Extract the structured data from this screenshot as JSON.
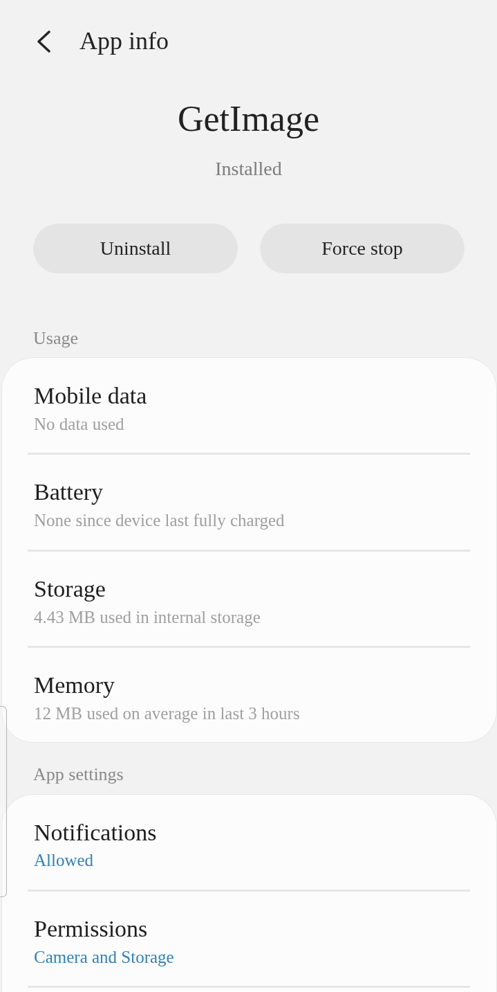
{
  "header": {
    "title": "App info"
  },
  "app": {
    "name": "GetImage",
    "status": "Installed"
  },
  "buttons": [
    {
      "label": "Uninstall"
    },
    {
      "label": "Force stop"
    }
  ],
  "sections": [
    {
      "title": "Usage",
      "continues": false,
      "items": [
        {
          "kind": "info",
          "title": "Mobile data",
          "summary": "No data used"
        },
        {
          "kind": "info",
          "title": "Battery",
          "summary": "None since device last fully charged"
        },
        {
          "kind": "info",
          "title": "Storage",
          "summary": "4.43 MB used in internal storage"
        },
        {
          "kind": "info",
          "title": "Memory",
          "summary": "12 MB used on average in last 3 hours"
        }
      ]
    },
    {
      "title": "App settings",
      "continues": true,
      "items": [
        {
          "kind": "value",
          "title": "Notifications",
          "summary": "Allowed"
        },
        {
          "kind": "value",
          "title": "Permissions",
          "summary": "Camera and Storage"
        }
      ]
    }
  ]
}
